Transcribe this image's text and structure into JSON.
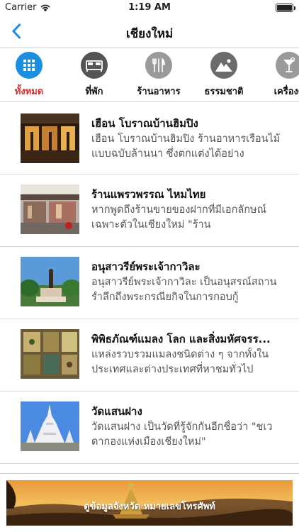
{
  "status_bar": {
    "carrier": "Carrier",
    "time": "1:19 AM"
  },
  "nav": {
    "title": "เชียงใหม่"
  },
  "categories": [
    {
      "label": "ทั้งหมด",
      "icon": "grid-icon",
      "active": true
    },
    {
      "label": "ที่พัก",
      "icon": "bed-icon",
      "active": false
    },
    {
      "label": "ร้านอาหาร",
      "icon": "utensils-icon",
      "active": false
    },
    {
      "label": "ธรรมชาติ",
      "icon": "mountain-icon",
      "active": false
    },
    {
      "label": "เครื่องดื่",
      "icon": "cocktail-icon",
      "active": false
    }
  ],
  "colors": {
    "accent": "#1a8fe0",
    "active_label": "#d0312d",
    "icon_gray": "#9a9a9a",
    "dark_icon": "#545454"
  },
  "items": [
    {
      "title": "เฮือน โบราณบ้านฮิมปิง",
      "description": "เฮือน โบราณบ้านฮิมปิง ร้านอาหารเรือนไม้แบบฉบับล้านนา ซึ่งตกแต่งได้อย่าง"
    },
    {
      "title": "ร้านแพรวพรรณ ไหมไทย",
      "description": "หากพูดถึงร้านขายของฝากที่มีเอกลักษณ์เฉพาะตัวในเชียงใหม่ \"ร้าน"
    },
    {
      "title": "อนุสาวรีย์พระเจ้ากาวิละ",
      "description": "อนุสาวรีย์พระเจ้ากาวิละ เป็นอนุสรณ์สถานรำลึกถึงพระกรณียกิจในการกอบกู้"
    },
    {
      "title": "พิพิธภัณฑ์แมลง โลก และสิ่งมหัศจรร...",
      "description": "แหล่งรวบรวมแมลงชนิดต่าง ๆ จากทั้งในประเทศและต่างประเทศที่หาชมทั่วไป"
    },
    {
      "title": "วัดแสนฝาง",
      "description": "วัดแสนฝาง เป็นวัดที่รู้จักกันอีกชื่อว่า \"ชเวดากองแห่งเมืองเชียงใหม่\""
    }
  ],
  "banner": {
    "text": "ดูข้อมูลจังหวัด หมายเลขโทรศัพท์"
  }
}
